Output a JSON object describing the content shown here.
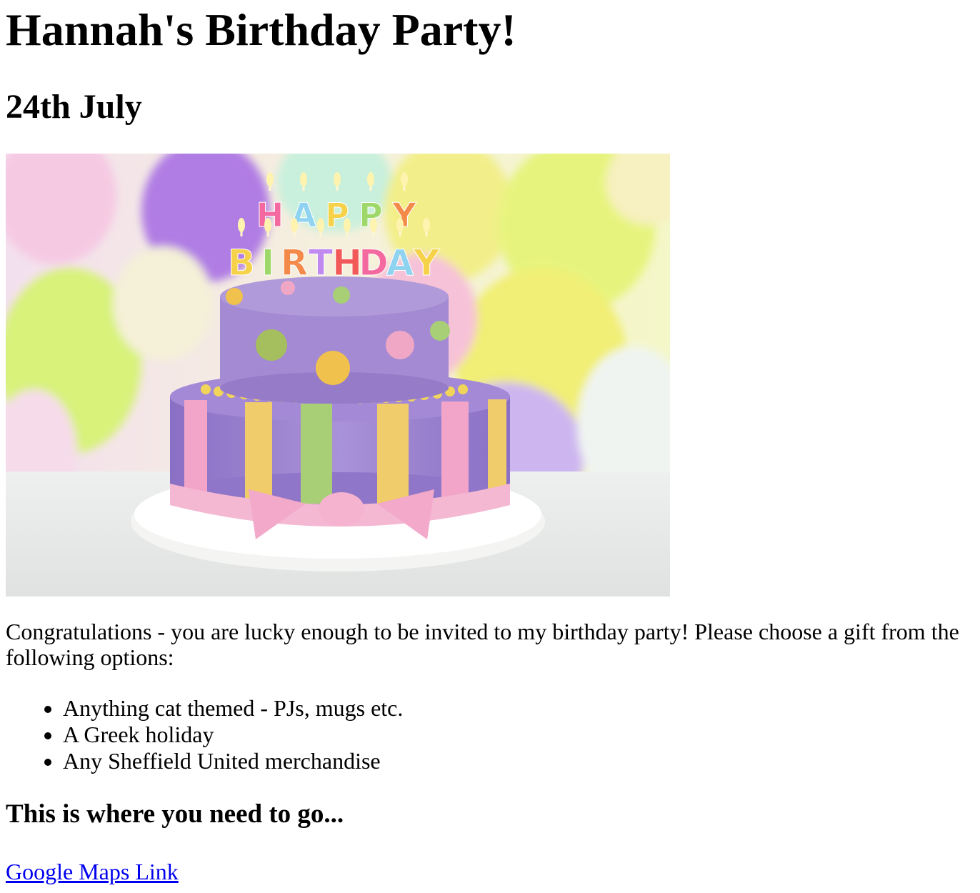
{
  "header": {
    "title": "Hannah's Birthday Party!",
    "date": "24th July"
  },
  "hero_image": {
    "candle_letters": [
      "H",
      "A",
      "P",
      "P",
      "Y",
      "B",
      "I",
      "R",
      "T",
      "H",
      "D",
      "A",
      "Y"
    ]
  },
  "invite": {
    "intro": "Congratulations - you are lucky enough to be invited to my birthday party! Please choose a gift from the following options:",
    "gifts": [
      "Anything cat themed - PJs, mugs etc.",
      "A Greek holiday",
      "Any Sheffield United merchandise"
    ]
  },
  "location": {
    "heading": "This is where you need to go...",
    "link_text": "Google Maps Link"
  },
  "colors": {
    "link": "#0000ee",
    "text": "#000000"
  }
}
